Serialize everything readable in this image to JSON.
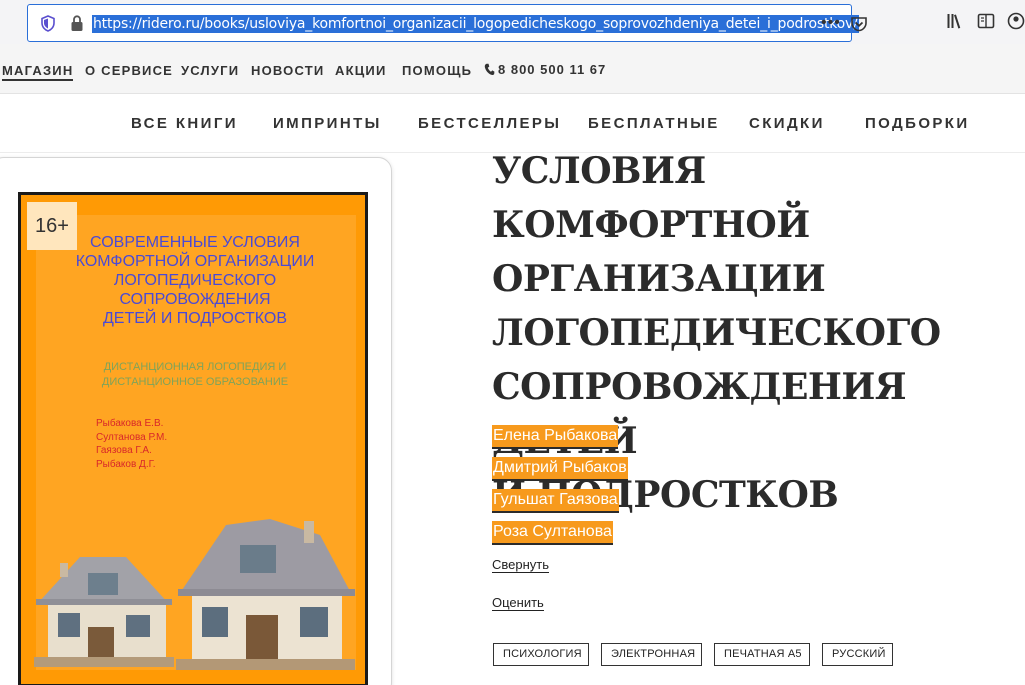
{
  "browser": {
    "url": "https://ridero.ru/books/usloviya_komfortnoi_organizacii_logopedicheskogo_soprovozhdeniya_detei_i_podrostkov/",
    "more_label": "•••"
  },
  "top_nav": {
    "items": [
      "МАГАЗИН",
      "О СЕРВИСЕ",
      "УСЛУГИ",
      "НОВОСТИ",
      "АКЦИИ",
      "ПОМОЩЬ"
    ],
    "phone": "8 800 500 11 67"
  },
  "category_nav": {
    "items": [
      "ВСЕ КНИГИ",
      "ИМПРИНТЫ",
      "БЕСТСЕЛЛЕРЫ",
      "БЕСПЛАТНЫЕ",
      "СКИДКИ",
      "ПОДБОРКИ"
    ]
  },
  "cover": {
    "age_rating": "16+",
    "title_lines": [
      "СОВРЕМЕННЫЕ УСЛОВИЯ",
      "КОМФОРТНОЙ ОРГАНИЗАЦИИ",
      "ЛОГОПЕДИЧЕСКОГО",
      "СОПРОВОЖДЕНИЯ",
      "ДЕТЕЙ И ПОДРОСТКОВ"
    ],
    "subtitle_lines": [
      "ДИСТАНЦИОННАЯ ЛОГОПЕДИЯ И",
      "ДИСТАНЦИОННОЕ ОБРАЗОВАНИЕ"
    ],
    "authors": [
      "Рыбакова Е.В.",
      "Султанова Р.М.",
      "Гаязова Г.А.",
      "Рыбаков Д.Г."
    ]
  },
  "book": {
    "title_lines": [
      "УСЛОВИЯ КОМФОРТНОЙ",
      "ОРГАНИЗАЦИИ",
      "ЛОГОПЕДИЧЕСКОГО",
      "СОПРОВОЖДЕНИЯ ДЕТЕЙ",
      "И ПОДРОСТКОВ"
    ],
    "authors": [
      "Елена Рыбакова",
      "Дмитрий Рыбаков",
      "Гульшат Гаязова",
      "Роза Султанова"
    ],
    "collapse_label": "Свернуть",
    "rate_label": "Оценить",
    "tags": [
      "ПСИХОЛОГИЯ",
      "ЭЛЕКТРОННАЯ",
      "ПЕЧАТНАЯ А5",
      "РУССКИЙ"
    ]
  },
  "colors": {
    "accent_orange": "#f79a1d",
    "cover_orange": "#ff9a05",
    "url_highlight": "#2a6fd8"
  }
}
